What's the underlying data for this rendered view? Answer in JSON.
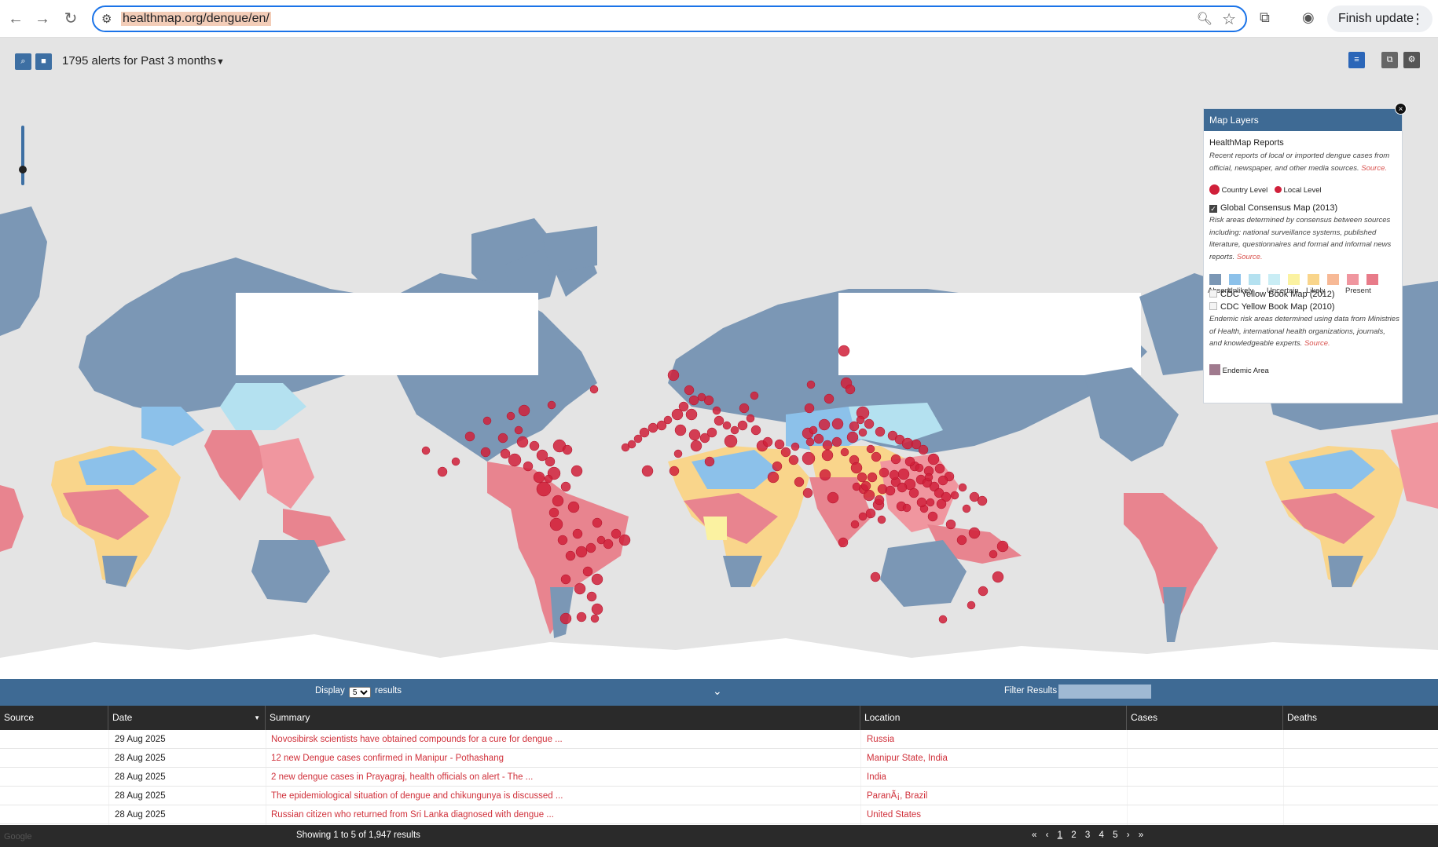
{
  "browser": {
    "url": "healthmap.org/dengue/en/",
    "finish_update_label": "Finish update"
  },
  "map_toolbar": {
    "alert_count": "1795",
    "alerts_text": "alerts for",
    "period": "Past 3 months"
  },
  "layers_panel": {
    "title": "Map Layers",
    "close_label": "×",
    "healthmap": {
      "title": "HealthMap Reports",
      "description": "Recent reports of local or imported dengue cases from official, newspaper, and other media sources.",
      "source": "Source.",
      "legend_country": "Country Level",
      "legend_local": "Local Level"
    },
    "consensus": {
      "title": "Global Consensus Map (2013)",
      "checked": true,
      "description": "Risk areas determined by consensus between sources including: national surveillance systems, published literature, questionnaires and formal and informal news reports.",
      "source": "Source.",
      "swatches": [
        {
          "label": "Absent",
          "color": "#7b97b5"
        },
        {
          "label": "Unlikely",
          "color": "#8cc1ea"
        },
        {
          "label": "",
          "color": "#b4e1f0"
        },
        {
          "label": "Uncertain",
          "color": "#c9edf5"
        },
        {
          "label": "",
          "color": "#fbf2a1"
        },
        {
          "label": "Likely",
          "color": "#f9d58b"
        },
        {
          "label": "",
          "color": "#f7b996"
        },
        {
          "label": "Present",
          "color": "#f0969f"
        },
        {
          "label": "",
          "color": "#e87b89"
        }
      ]
    },
    "cdc_2012": {
      "title": "CDC Yellow Book Map (2012)",
      "checked": false
    },
    "cdc_2010": {
      "title": "CDC Yellow Book Map (2010)",
      "checked": false
    },
    "cdc_description": "Endemic risk areas determined using data from Ministries of Health, international health organizations, journals, and knowledgeable experts.",
    "cdc_source": "Source.",
    "endemic_label": "Endemic Area",
    "endemic_color": "#a07a8e"
  },
  "results_bar": {
    "display_label": "Display",
    "display_value": "5",
    "results_label": "results",
    "filter_label": "Filter Results",
    "filter_value": ""
  },
  "table": {
    "columns": [
      "Source",
      "Date",
      "Summary",
      "Location",
      "Cases",
      "Deaths"
    ],
    "rows": [
      {
        "date": "29 Aug 2025",
        "summary": "Novosibirsk scientists have obtained compounds for a cure for dengue ...",
        "location": "Russia",
        "cases": "",
        "deaths": ""
      },
      {
        "date": "28 Aug 2025",
        "summary": "12 new Dengue cases confirmed in Manipur - Pothashang",
        "location": "Manipur State, India",
        "cases": "",
        "deaths": ""
      },
      {
        "date": "28 Aug 2025",
        "summary": "2 new dengue cases in Prayagraj, health officials on alert - The ...",
        "location": "India",
        "cases": "",
        "deaths": ""
      },
      {
        "date": "28 Aug 2025",
        "summary": "The epidemiological situation of dengue and chikungunya is discussed ...",
        "location": "ParanÃ¡, Brazil",
        "cases": "",
        "deaths": ""
      },
      {
        "date": "28 Aug 2025",
        "summary": "Russian citizen who returned from Sri Lanka diagnosed with dengue ...",
        "location": "United States",
        "cases": "",
        "deaths": ""
      }
    ]
  },
  "footer": {
    "showing": "Showing 1 to 5 of 1,947 results",
    "pages": [
      "1",
      "2",
      "3",
      "4",
      "5"
    ],
    "current_page": "1"
  },
  "colors": {
    "ocean": "#e4e4e4",
    "absent": "#7b97b5",
    "unlikely": "#8cc1ea",
    "uncertain": "#fbf2a1",
    "likely": "#f9d58b",
    "present": "#e8848f",
    "marker": "#d0203a",
    "bar": "#3e6a94"
  }
}
